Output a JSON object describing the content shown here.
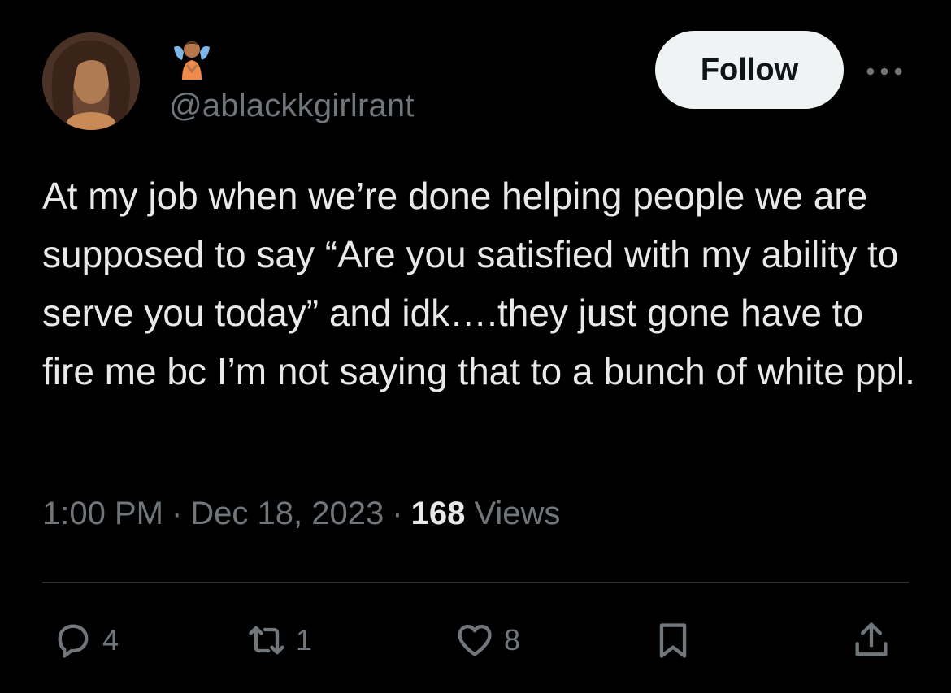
{
  "user": {
    "name_emoji": "person-with-wings-emoji",
    "handle": "@ablackkgirlrant",
    "follow_label": "Follow"
  },
  "tweet": {
    "text": "At my job when we’re done helping people we are supposed to say “Are you satisfied with my ability to serve you today” and idk….they just gone have to fire me bc I’m not saying that to a bunch of white ppl.",
    "time": "1:00 PM",
    "date": "Dec 18, 2023",
    "views_count": "168",
    "views_label": "Views"
  },
  "actions": {
    "replies": "4",
    "retweets": "1",
    "likes": "8"
  },
  "icons": [
    "more-icon",
    "reply-icon",
    "retweet-icon",
    "like-icon",
    "bookmark-icon",
    "share-icon"
  ],
  "colors": {
    "background": "#000000",
    "text": "#e7e9ea",
    "secondary": "#71767b",
    "button_bg": "#eff3f4",
    "divider": "#2f3336"
  }
}
